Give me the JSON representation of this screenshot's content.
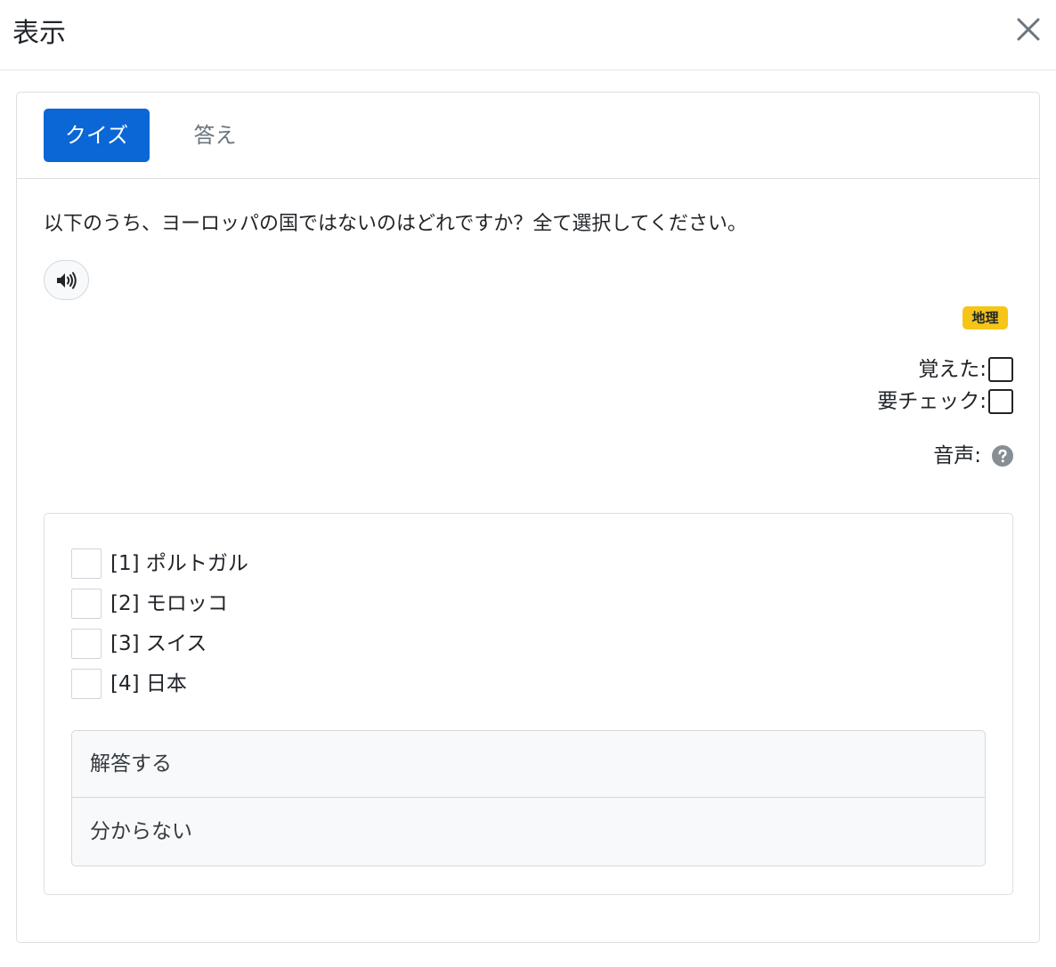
{
  "modal": {
    "title": "表示",
    "close_icon": "close-icon"
  },
  "tabs": [
    {
      "label": "クイズ",
      "active": true
    },
    {
      "label": "答え",
      "active": false
    }
  ],
  "question": {
    "text": "以下のうち、ヨーロッパの国ではないのはどれですか？全て選択してください。",
    "audio_icon": "speaker-icon"
  },
  "tag": {
    "label": "地理",
    "color": "#f5c518"
  },
  "flags": {
    "memorized_label": "覚えた:",
    "memorized_checked": false,
    "needs_check_label": "要チェック:",
    "needs_check_checked": false
  },
  "voice": {
    "label": "音声:",
    "help_icon": "question-circle-icon"
  },
  "options": [
    {
      "label": "[1] ポルトガル",
      "checked": false
    },
    {
      "label": "[2] モロッコ",
      "checked": false
    },
    {
      "label": "[3] スイス",
      "checked": false
    },
    {
      "label": "[4] 日本",
      "checked": false
    }
  ],
  "actions": {
    "submit_label": "解答する",
    "dont_know_label": "分からない"
  },
  "colors": {
    "accent": "#0b66d6",
    "muted": "#6c757d"
  }
}
